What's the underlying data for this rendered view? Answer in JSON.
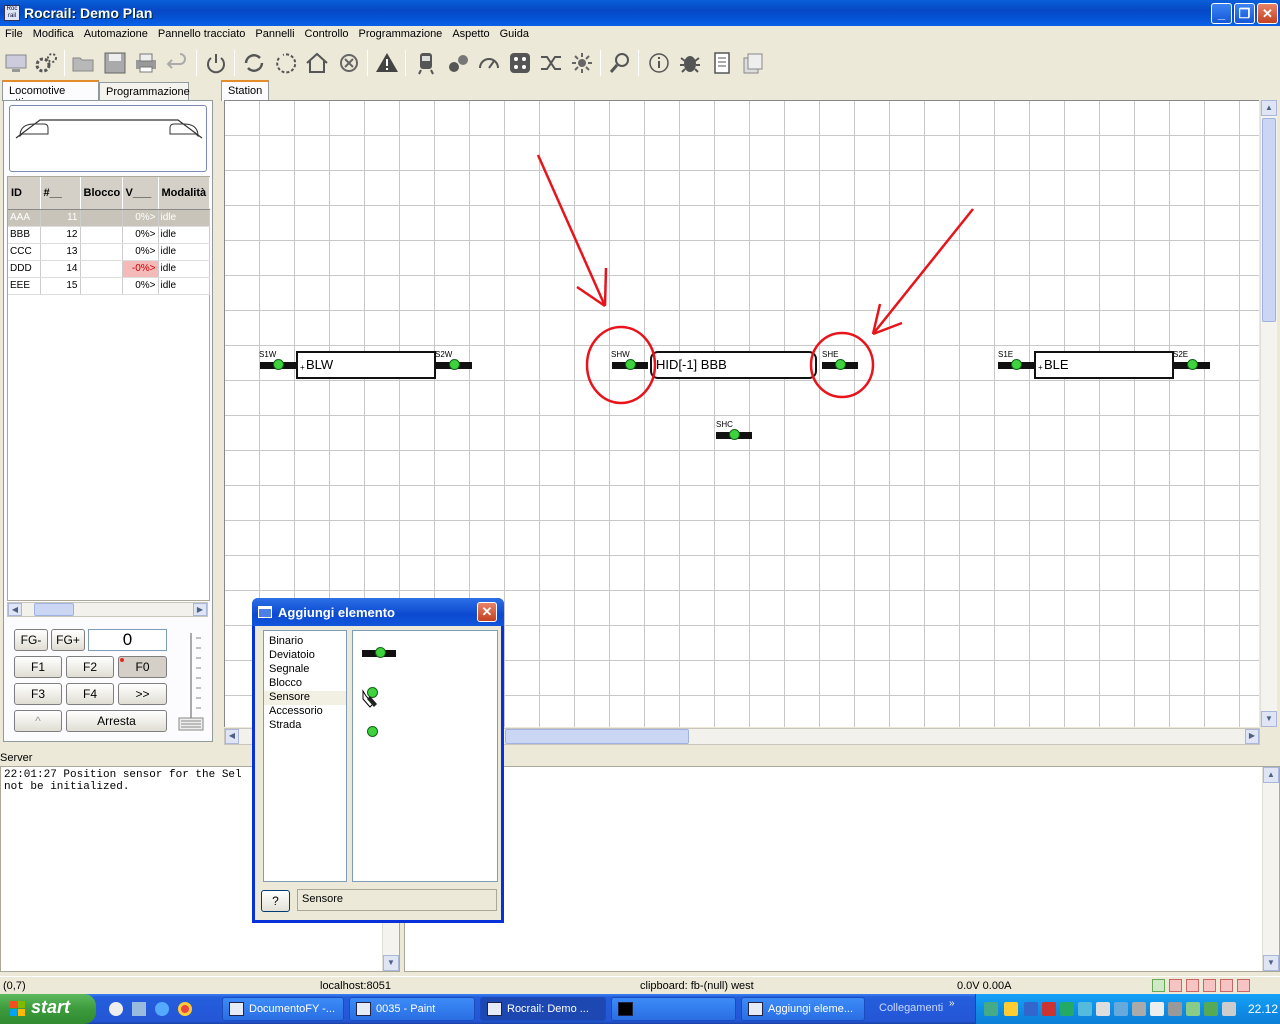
{
  "window": {
    "title": "Rocrail: Demo Plan"
  },
  "menu": [
    "File",
    "Modifica",
    "Automazione",
    "Pannello tracciato",
    "Pannelli",
    "Controllo",
    "Programmazione",
    "Aspetto",
    "Guida"
  ],
  "toolbar_icons": [
    "monitor-icon",
    "gears-icon",
    "open-folder-icon",
    "save-icon",
    "print-icon",
    "undo-icon",
    "power-icon",
    "sync-icon",
    "refresh-icon",
    "home-icon",
    "cancel-icon",
    "warning-icon",
    "train-icon",
    "locomotive-icon",
    "speedometer-icon",
    "network-icon",
    "shuffle-icon",
    "light-icon",
    "zoom-icon",
    "info-icon",
    "bug-icon",
    "document-icon",
    "pages-icon"
  ],
  "left_panel": {
    "tabs": [
      "Locomotive attive",
      "Programmazione"
    ],
    "table": {
      "headers": [
        "ID",
        "#__",
        "Blocco",
        "V___",
        "Modalità"
      ],
      "rows": [
        {
          "id": "AAA",
          "num": "11",
          "block": "",
          "v": "0%>",
          "mode": "idle"
        },
        {
          "id": "BBB",
          "num": "12",
          "block": "",
          "v": "0%>",
          "mode": "idle"
        },
        {
          "id": "CCC",
          "num": "13",
          "block": "",
          "v": "0%>",
          "mode": "idle"
        },
        {
          "id": "DDD",
          "num": "14",
          "block": "",
          "v": "-0%>",
          "mode": "idle"
        },
        {
          "id": "EEE",
          "num": "15",
          "block": "",
          "v": "0%>",
          "mode": "idle"
        }
      ]
    },
    "controls": {
      "fg_minus": "FG-",
      "fg_plus": "FG+",
      "speed": "0",
      "f1": "F1",
      "f2": "F2",
      "f0": "F0",
      "f3": "F3",
      "f4": "F4",
      "more": ">>",
      "dir": "^",
      "stop": "Arresta"
    }
  },
  "canvas": {
    "tab": "Station",
    "blocks": [
      "BLW",
      "HID[-1] BBB",
      "BLE"
    ],
    "sensors": [
      "S1W",
      "S2W",
      "SHW",
      "SHE",
      "S1E",
      "S2E",
      "SHC"
    ]
  },
  "server": {
    "label": "Server",
    "log": "22:01:27 Position sensor for the Sel\nnot be initialized."
  },
  "dialog": {
    "title": "Aggiungi elemento",
    "items": [
      "Binario",
      "Deviatoio",
      "Segnale",
      "Blocco",
      "Sensore",
      "Accessorio",
      "Strada"
    ],
    "selected": "Sensore",
    "help": "?",
    "status": "Sensore"
  },
  "statusbar": {
    "coords": "(0,7)",
    "host": "localhost:8051",
    "clipboard": "clipboard: fb-(null) west",
    "power": "0.0V 0.00A"
  },
  "taskbar": {
    "start": "start",
    "tasks": [
      "DocumentoFY -...",
      "0035 - Paint",
      "Rocrail: Demo ...",
      "",
      "Aggiungi eleme..."
    ],
    "links": "Collegamenti",
    "clock": "22.12"
  }
}
